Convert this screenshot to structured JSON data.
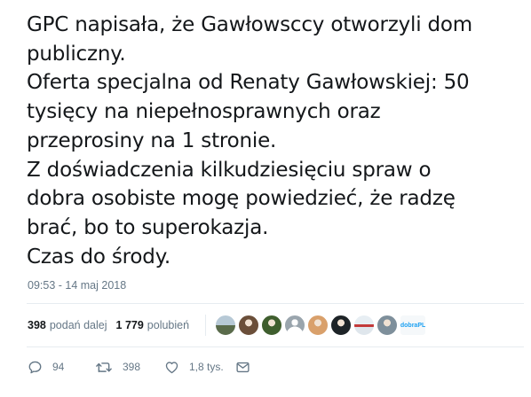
{
  "tweet": {
    "lines": [
      "GPC napisała, że Gawłowsccy otworzyli dom",
      "publiczny.",
      "Oferta specjalna od Renaty Gawłowskiej: 50",
      "tysięcy na niepełnosprawnych oraz",
      "przeprosiny na 1 stronie.",
      "Z doświadczenia kilkudziesięciu spraw o",
      "dobra osobiste mogę powiedzieć, że radzę",
      "brać, bo to superokazja.",
      "Czas do środy."
    ],
    "timestamp": "09:53 - 14 maj 2018"
  },
  "stats": {
    "retweets_count": "398",
    "retweets_label": "podań dalej",
    "likes_count": "1 779",
    "likes_label": "polubień"
  },
  "likers": [
    {
      "icon": "avatar-landscape",
      "color": "#8aa3b5"
    },
    {
      "icon": "avatar-person-dark",
      "color": "#6b4f3a"
    },
    {
      "icon": "avatar-person-green",
      "color": "#3f5e2e"
    },
    {
      "icon": "avatar-default",
      "color": "#9aa5ad"
    },
    {
      "icon": "avatar-face",
      "color": "#d9a06b"
    },
    {
      "icon": "avatar-bird-dark",
      "color": "#1d2327"
    },
    {
      "icon": "avatar-flag",
      "color": "#c8d3dc"
    },
    {
      "icon": "avatar-person-light",
      "color": "#7e8f9b"
    }
  ],
  "liker_tag": "dobraPL",
  "actions": {
    "reply_count": "94",
    "retweet_count": "398",
    "like_count": "1,8 tys."
  },
  "colors": {
    "text": "#14171a",
    "muted": "#657786",
    "divider": "#e6ecf0"
  }
}
